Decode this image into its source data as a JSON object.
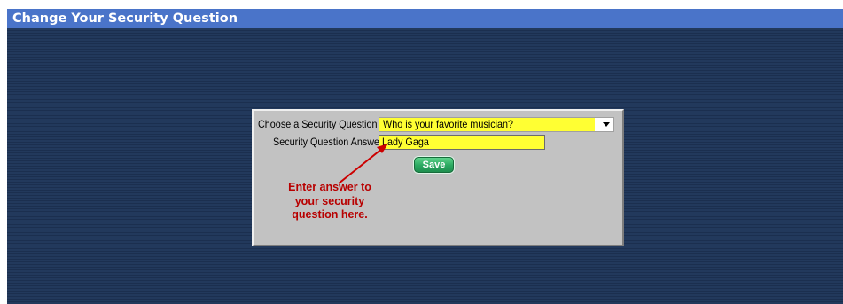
{
  "window": {
    "title": "Change Your Security Question"
  },
  "form": {
    "question_label": "Choose a Security Question",
    "question_selected": "Who is your favorite musician?",
    "answer_label": "Security Question Answer",
    "answer_value": "Lady Gaga",
    "save_label": "Save"
  },
  "annotation": {
    "lines": [
      "Enter answer to",
      "your security",
      "question here."
    ]
  },
  "icons": {
    "dropdown": "chevron-down-icon",
    "pointer": "arrow-icon"
  },
  "colors": {
    "title_bar": "#4a74c9",
    "background": "#1f3556",
    "panel": "#c2c2c2",
    "highlight_field": "#ffff33",
    "save_button": "#2aa860",
    "annotation_text": "#b80000"
  }
}
